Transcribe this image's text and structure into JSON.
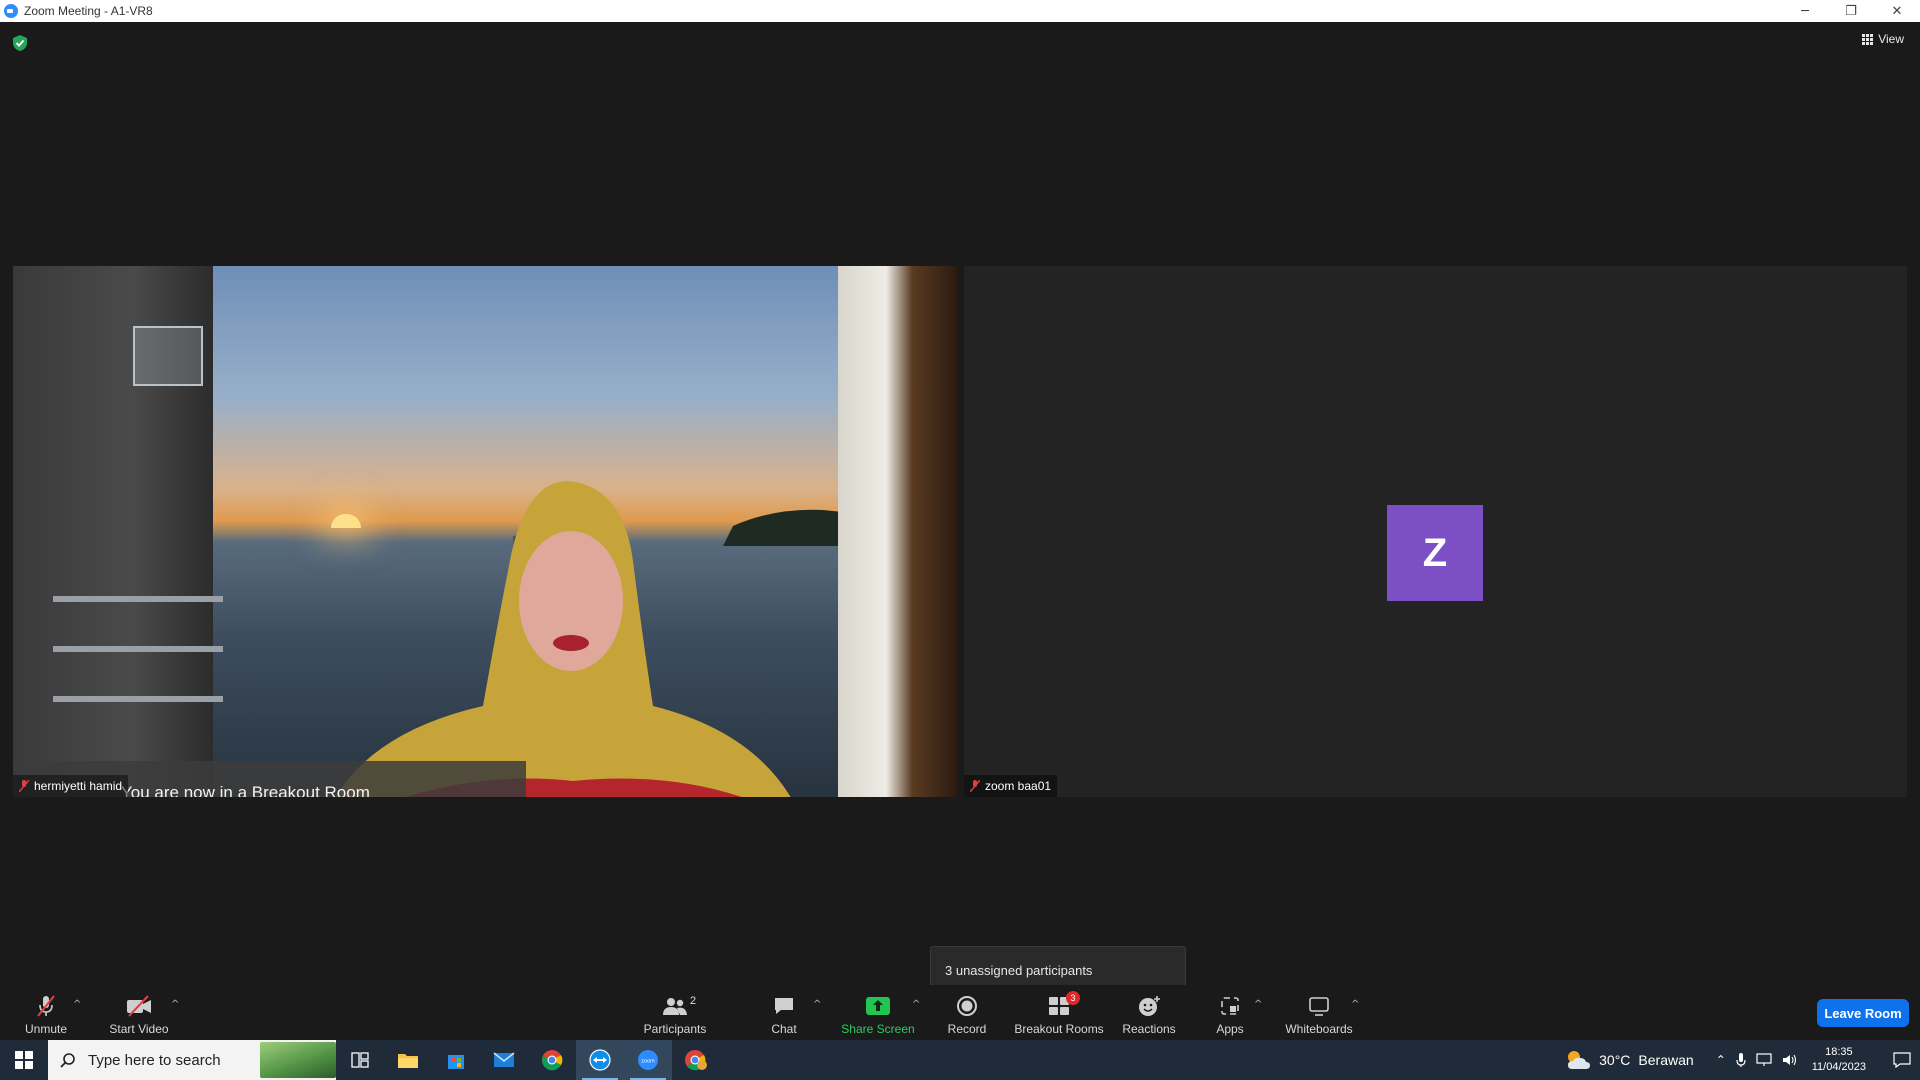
{
  "window": {
    "title": "Zoom Meeting - A1-VR8",
    "minimize": "─",
    "restore": "❐",
    "close": "✕"
  },
  "meeting": {
    "view_label": "View",
    "banner": "You are now in a Breakout Room",
    "tiles": [
      {
        "name": "hermiyetti hamid",
        "muted": true
      },
      {
        "name": "zoom baa01",
        "muted": true,
        "avatar_letter": "Z",
        "avatar_color": "#7d4fc4"
      }
    ],
    "tooltip": "3 unassigned participants"
  },
  "toolbar": {
    "unmute": "Unmute",
    "start_video": "Start Video",
    "participants": "Participants",
    "participants_count": "2",
    "chat": "Chat",
    "share_screen": "Share Screen",
    "record": "Record",
    "breakout_rooms": "Breakout Rooms",
    "breakout_badge": "3",
    "reactions": "Reactions",
    "apps": "Apps",
    "whiteboards": "Whiteboards",
    "leave_room": "Leave Room",
    "caret": "^",
    "accent_share": "#2ecc5f",
    "accent_leave": "#0e72ed"
  },
  "taskbar": {
    "search_placeholder": "Type here to search",
    "apps": [
      "task-view",
      "file-explorer",
      "microsoft-store",
      "mail",
      "chrome",
      "teamviewer",
      "zoom",
      "chrome-profile"
    ],
    "weather_temp": "30°C",
    "weather_text": "Berawan",
    "time": "18:35",
    "date": "11/04/2023"
  }
}
